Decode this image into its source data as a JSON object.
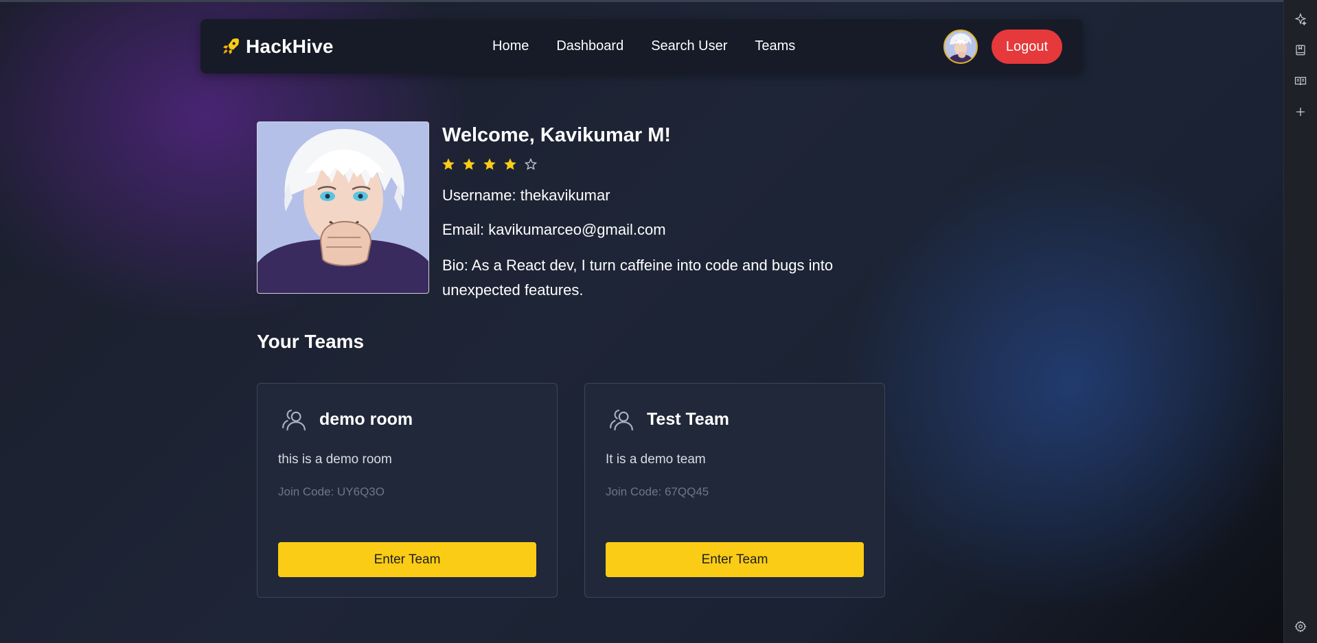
{
  "brand": {
    "name": "HackHive",
    "icon": "rocket-icon",
    "icon_color": "#facc15"
  },
  "nav": {
    "links": [
      {
        "label": "Home"
      },
      {
        "label": "Dashboard"
      },
      {
        "label": "Search User"
      },
      {
        "label": "Teams"
      }
    ],
    "logout_label": "Logout",
    "logout_color": "#e5393b"
  },
  "profile": {
    "welcome": "Welcome, Kavikumar M!",
    "rating": {
      "value": 4,
      "max": 5
    },
    "username": "Username: thekavikumar",
    "email": "Email: kavikumarceo@gmail.com",
    "bio": "Bio: As a React dev, I turn caffeine into code and bugs into unexpected features."
  },
  "teams_heading": "Your Teams",
  "teams": [
    {
      "name": "demo room",
      "description": "this is a demo room",
      "join_code": "Join Code: UY6Q3O",
      "button": "Enter Team"
    },
    {
      "name": "Test Team",
      "description": "It is a demo team",
      "join_code": "Join Code: 67QQ45",
      "button": "Enter Team"
    }
  ],
  "browser_sidebar": {
    "icons": [
      "sparkle-icon",
      "bookmark-icon",
      "reading-list-icon",
      "plus-icon",
      "settings-icon"
    ]
  },
  "colors": {
    "accent": "#facc15",
    "star": "#facc15",
    "danger": "#e5393b"
  }
}
